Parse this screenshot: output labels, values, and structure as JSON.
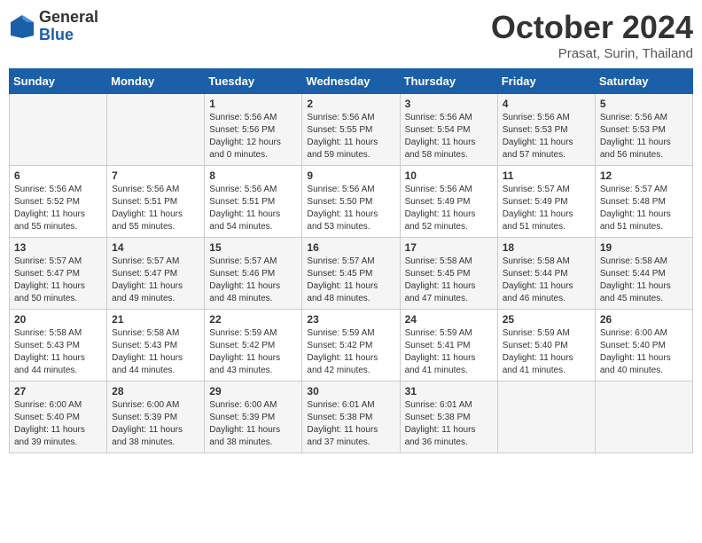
{
  "header": {
    "logo_general": "General",
    "logo_blue": "Blue",
    "month": "October 2024",
    "location": "Prasat, Surin, Thailand"
  },
  "days_of_week": [
    "Sunday",
    "Monday",
    "Tuesday",
    "Wednesday",
    "Thursday",
    "Friday",
    "Saturday"
  ],
  "weeks": [
    [
      {
        "day": "",
        "info": ""
      },
      {
        "day": "",
        "info": ""
      },
      {
        "day": "1",
        "info": "Sunrise: 5:56 AM\nSunset: 5:56 PM\nDaylight: 12 hours\nand 0 minutes."
      },
      {
        "day": "2",
        "info": "Sunrise: 5:56 AM\nSunset: 5:55 PM\nDaylight: 11 hours\nand 59 minutes."
      },
      {
        "day": "3",
        "info": "Sunrise: 5:56 AM\nSunset: 5:54 PM\nDaylight: 11 hours\nand 58 minutes."
      },
      {
        "day": "4",
        "info": "Sunrise: 5:56 AM\nSunset: 5:53 PM\nDaylight: 11 hours\nand 57 minutes."
      },
      {
        "day": "5",
        "info": "Sunrise: 5:56 AM\nSunset: 5:53 PM\nDaylight: 11 hours\nand 56 minutes."
      }
    ],
    [
      {
        "day": "6",
        "info": "Sunrise: 5:56 AM\nSunset: 5:52 PM\nDaylight: 11 hours\nand 55 minutes."
      },
      {
        "day": "7",
        "info": "Sunrise: 5:56 AM\nSunset: 5:51 PM\nDaylight: 11 hours\nand 55 minutes."
      },
      {
        "day": "8",
        "info": "Sunrise: 5:56 AM\nSunset: 5:51 PM\nDaylight: 11 hours\nand 54 minutes."
      },
      {
        "day": "9",
        "info": "Sunrise: 5:56 AM\nSunset: 5:50 PM\nDaylight: 11 hours\nand 53 minutes."
      },
      {
        "day": "10",
        "info": "Sunrise: 5:56 AM\nSunset: 5:49 PM\nDaylight: 11 hours\nand 52 minutes."
      },
      {
        "day": "11",
        "info": "Sunrise: 5:57 AM\nSunset: 5:49 PM\nDaylight: 11 hours\nand 51 minutes."
      },
      {
        "day": "12",
        "info": "Sunrise: 5:57 AM\nSunset: 5:48 PM\nDaylight: 11 hours\nand 51 minutes."
      }
    ],
    [
      {
        "day": "13",
        "info": "Sunrise: 5:57 AM\nSunset: 5:47 PM\nDaylight: 11 hours\nand 50 minutes."
      },
      {
        "day": "14",
        "info": "Sunrise: 5:57 AM\nSunset: 5:47 PM\nDaylight: 11 hours\nand 49 minutes."
      },
      {
        "day": "15",
        "info": "Sunrise: 5:57 AM\nSunset: 5:46 PM\nDaylight: 11 hours\nand 48 minutes."
      },
      {
        "day": "16",
        "info": "Sunrise: 5:57 AM\nSunset: 5:45 PM\nDaylight: 11 hours\nand 48 minutes."
      },
      {
        "day": "17",
        "info": "Sunrise: 5:58 AM\nSunset: 5:45 PM\nDaylight: 11 hours\nand 47 minutes."
      },
      {
        "day": "18",
        "info": "Sunrise: 5:58 AM\nSunset: 5:44 PM\nDaylight: 11 hours\nand 46 minutes."
      },
      {
        "day": "19",
        "info": "Sunrise: 5:58 AM\nSunset: 5:44 PM\nDaylight: 11 hours\nand 45 minutes."
      }
    ],
    [
      {
        "day": "20",
        "info": "Sunrise: 5:58 AM\nSunset: 5:43 PM\nDaylight: 11 hours\nand 44 minutes."
      },
      {
        "day": "21",
        "info": "Sunrise: 5:58 AM\nSunset: 5:43 PM\nDaylight: 11 hours\nand 44 minutes."
      },
      {
        "day": "22",
        "info": "Sunrise: 5:59 AM\nSunset: 5:42 PM\nDaylight: 11 hours\nand 43 minutes."
      },
      {
        "day": "23",
        "info": "Sunrise: 5:59 AM\nSunset: 5:42 PM\nDaylight: 11 hours\nand 42 minutes."
      },
      {
        "day": "24",
        "info": "Sunrise: 5:59 AM\nSunset: 5:41 PM\nDaylight: 11 hours\nand 41 minutes."
      },
      {
        "day": "25",
        "info": "Sunrise: 5:59 AM\nSunset: 5:40 PM\nDaylight: 11 hours\nand 41 minutes."
      },
      {
        "day": "26",
        "info": "Sunrise: 6:00 AM\nSunset: 5:40 PM\nDaylight: 11 hours\nand 40 minutes."
      }
    ],
    [
      {
        "day": "27",
        "info": "Sunrise: 6:00 AM\nSunset: 5:40 PM\nDaylight: 11 hours\nand 39 minutes."
      },
      {
        "day": "28",
        "info": "Sunrise: 6:00 AM\nSunset: 5:39 PM\nDaylight: 11 hours\nand 38 minutes."
      },
      {
        "day": "29",
        "info": "Sunrise: 6:00 AM\nSunset: 5:39 PM\nDaylight: 11 hours\nand 38 minutes."
      },
      {
        "day": "30",
        "info": "Sunrise: 6:01 AM\nSunset: 5:38 PM\nDaylight: 11 hours\nand 37 minutes."
      },
      {
        "day": "31",
        "info": "Sunrise: 6:01 AM\nSunset: 5:38 PM\nDaylight: 11 hours\nand 36 minutes."
      },
      {
        "day": "",
        "info": ""
      },
      {
        "day": "",
        "info": ""
      }
    ]
  ]
}
